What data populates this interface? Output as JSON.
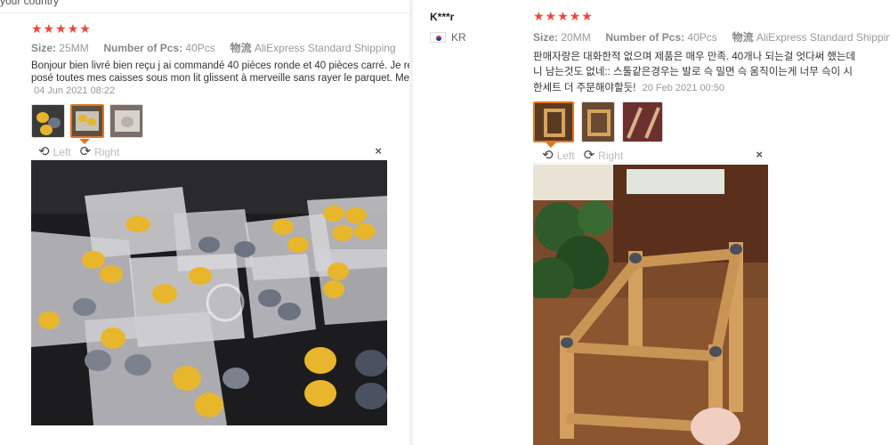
{
  "left_review": {
    "header_cut": "your country",
    "stars": "★★★★★",
    "size_label": "Size:",
    "size_value": "25MM",
    "pcs_label": "Number of Pcs:",
    "pcs_value": "40Pcs",
    "shipping_label": "物流",
    "shipping_value": "AliExpress Standard Shipping",
    "text_line1": "Bonjour bien livré bien reçu j ai commandé 40 pièces ronde et 40 pièces carré. Je recom",
    "text_line2": "posé toutes mes caisses sous mon lit glissent à merveille sans rayer le parquet. Merci bi",
    "date": "04 Jun 2021 08:22",
    "thumbnails": [
      "thumb-1",
      "thumb-2",
      "thumb-3"
    ],
    "viewer": {
      "left_label": "Left",
      "right_label": "Right",
      "close": "×"
    }
  },
  "right_review": {
    "username": "K***r",
    "country_code": "KR",
    "stars": "★★★★★",
    "size_label": "Size:",
    "size_value": "20MM",
    "pcs_label": "Number of Pcs:",
    "pcs_value": "40Pcs",
    "shipping_label": "物流",
    "shipping_value": "AliExpress Standard Shipping",
    "text_line1": "판매자랑은 대화한적 없으며 제품은 매우 만족. 40개나 되는걸 엇다써 했는데",
    "text_line2": "니 남는것도 없네:: 스툴같은경우는 발로 슥 밀면 슥 움직이는게 너무 슥이 시",
    "text_line3": "한세트 더 주문해야할듯!",
    "date": "20 Feb 2021 00:50",
    "thumbnails": [
      "thumb-1",
      "thumb-2",
      "thumb-3"
    ],
    "viewer": {
      "left_label": "Left",
      "right_label": "Right",
      "close": "×"
    }
  },
  "colors": {
    "stars": "#f2453b",
    "active_thumb": "#e5751f",
    "muted_text": "#999999"
  }
}
